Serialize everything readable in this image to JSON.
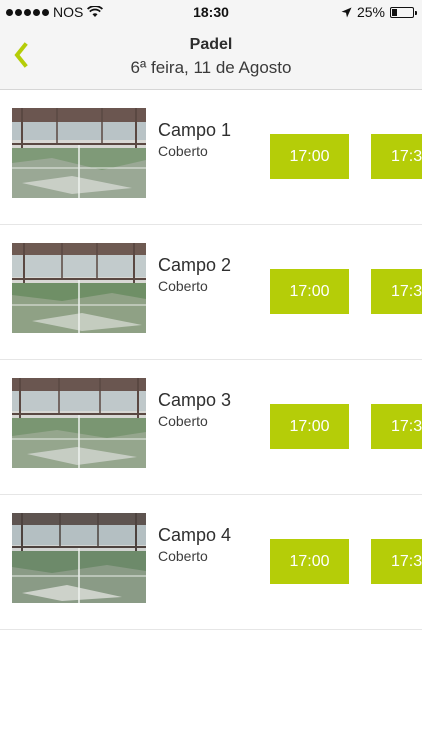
{
  "status_bar": {
    "carrier": "NOS",
    "time": "18:30",
    "battery": "25%"
  },
  "header": {
    "title": "Padel",
    "subtitle": "6ª feira, 11 de Agosto"
  },
  "colors": {
    "accent": "#b5cd08"
  },
  "courts": [
    {
      "name": "Campo 1",
      "type": "Coberto",
      "slots": [
        "17:00",
        "17:3"
      ]
    },
    {
      "name": "Campo 2",
      "type": "Coberto",
      "slots": [
        "17:00",
        "17:3"
      ]
    },
    {
      "name": "Campo 3",
      "type": "Coberto",
      "slots": [
        "17:00",
        "17:3"
      ]
    },
    {
      "name": "Campo 4",
      "type": "Coberto",
      "slots": [
        "17:00",
        "17:3"
      ]
    }
  ]
}
